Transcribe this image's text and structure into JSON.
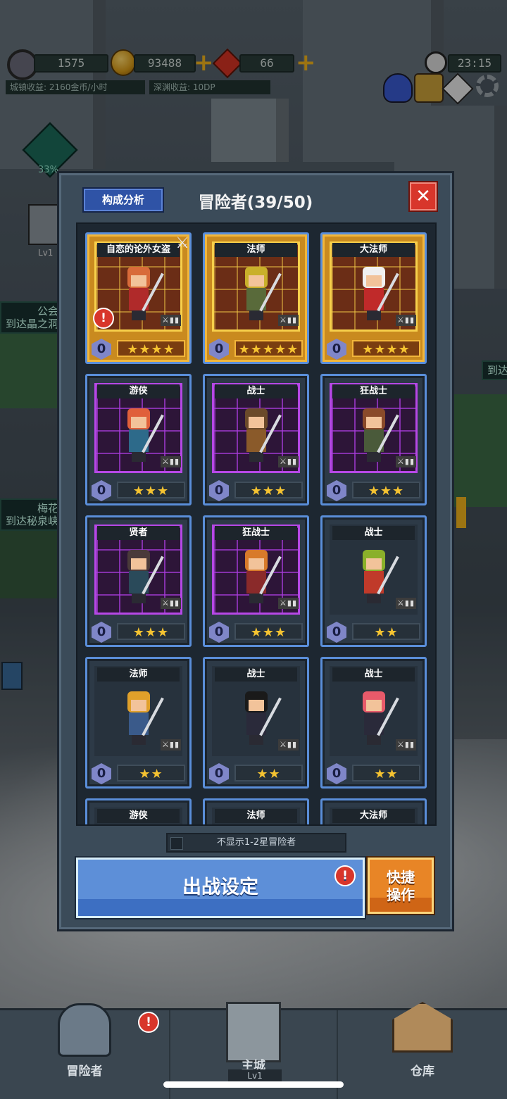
{
  "hud": {
    "pickaxe_value": "1575",
    "gold_value": "93488",
    "gem_value": "66",
    "time": "23:15",
    "town_income": "城镇收益: 2160金币/小时",
    "abyss_income": "深渊收益: 10DP",
    "icons": [
      "pickaxe-icon",
      "gold-coin-icon",
      "red-gem-icon",
      "clock-icon",
      "adventurer-group-icon",
      "crown-event-icon",
      "compass-icon",
      "settings-gear-icon"
    ]
  },
  "scene": {
    "progress_label": "33%",
    "building_level": "Lv1",
    "left_labels": [
      {
        "title": "公会",
        "sub": "到达晶之洞"
      },
      {
        "title": "梅花",
        "sub": "到达秘泉峡"
      }
    ],
    "right_label": "到达"
  },
  "dialog": {
    "compose_button": "构成分析",
    "title": "冒险者(39/50)",
    "close_label": "✕",
    "filter_label": "不显示1-2星冒险者",
    "battle_button": "出战设定",
    "quick_button_line1": "快捷",
    "quick_button_line2": "操作"
  },
  "cards": [
    {
      "name": "自恋的论外女盗",
      "level": "0",
      "stars": "★★★★",
      "rarity": "gold",
      "hair": "#d86b3a",
      "outfit": "#b02a2a",
      "alert": true,
      "crossed_swords": true
    },
    {
      "name": "法师",
      "level": "0",
      "stars": "★★★★★",
      "rarity": "gold",
      "hair": "#c9b02a",
      "outfit": "#596a3a",
      "alert": false
    },
    {
      "name": "大法师",
      "level": "0",
      "stars": "★★★★",
      "rarity": "gold",
      "hair": "#f0f0f0",
      "outfit": "#c02a2a",
      "alert": false
    },
    {
      "name": "游侠",
      "level": "0",
      "stars": "★★★",
      "rarity": "purple",
      "hair": "#e0603a",
      "outfit": "#2d6a8a",
      "alert": false
    },
    {
      "name": "战士",
      "level": "0",
      "stars": "★★★",
      "rarity": "purple",
      "hair": "#6b4a2a",
      "outfit": "#8a5a2a",
      "alert": false
    },
    {
      "name": "狂战士",
      "level": "0",
      "stars": "★★★",
      "rarity": "purple",
      "hair": "#8a4a2a",
      "outfit": "#4a5a3a",
      "alert": false
    },
    {
      "name": "贤者",
      "level": "0",
      "stars": "★★★",
      "rarity": "purple",
      "hair": "#4a3a3a",
      "outfit": "#2a4a5a",
      "alert": false
    },
    {
      "name": "狂战士",
      "level": "0",
      "stars": "★★★",
      "rarity": "purple",
      "hair": "#d87a2a",
      "outfit": "#8a2a2a",
      "alert": false
    },
    {
      "name": "战士",
      "level": "0",
      "stars": "★★",
      "rarity": "plain",
      "hair": "#8ab02a",
      "outfit": "#c03a2a",
      "alert": false
    },
    {
      "name": "法师",
      "level": "0",
      "stars": "★★",
      "rarity": "plain",
      "hair": "#e0a02a",
      "outfit": "#3a5a8a",
      "alert": false
    },
    {
      "name": "战士",
      "level": "0",
      "stars": "★★",
      "rarity": "plain",
      "hair": "#1a1a1a",
      "outfit": "#2a2a3a",
      "alert": false
    },
    {
      "name": "战士",
      "level": "0",
      "stars": "★★",
      "rarity": "plain",
      "hair": "#e85a6a",
      "outfit": "#2a2a3a",
      "alert": false
    },
    {
      "name": "游侠",
      "level": "",
      "stars": "",
      "rarity": "plain",
      "partial": true
    },
    {
      "name": "法师",
      "level": "",
      "stars": "",
      "rarity": "plain",
      "partial": true
    },
    {
      "name": "大法师",
      "level": "",
      "stars": "",
      "rarity": "plain",
      "partial": true
    }
  ],
  "nav": {
    "items": [
      {
        "label": "冒险者",
        "icon": "knight-helmet-icon",
        "alert": true
      },
      {
        "label": "主城",
        "icon": "castle-tower-icon",
        "sub": "Lv1"
      },
      {
        "label": "仓库",
        "icon": "warehouse-icon"
      }
    ]
  },
  "colors": {
    "panel_bg": "#3b4b59",
    "card_border": "#5a8ed9",
    "gold_frame": "#f2b63a",
    "purple_frame": "#b648e6",
    "battle_button": "#5d8fd8",
    "quick_button": "#e88526",
    "close_button": "#d8362b"
  }
}
